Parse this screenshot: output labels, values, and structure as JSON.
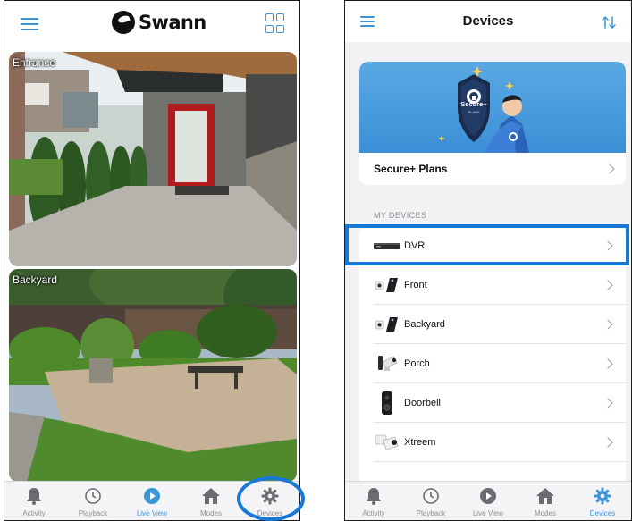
{
  "left_screen": {
    "header": {
      "logo_text": "Swann"
    },
    "cameras": [
      {
        "label": "Entrance"
      },
      {
        "label": "Backyard"
      }
    ],
    "tabs": [
      {
        "label": "Activity",
        "icon": "bell-icon"
      },
      {
        "label": "Playback",
        "icon": "history-icon"
      },
      {
        "label": "Live View",
        "icon": "play-icon"
      },
      {
        "label": "Modes",
        "icon": "home-icon"
      },
      {
        "label": "Devices",
        "icon": "gear-icon"
      }
    ],
    "active_tab": "Live View"
  },
  "right_screen": {
    "header": {
      "title": "Devices"
    },
    "promo": {
      "title": "Secure+ Plans",
      "badge_text": "Secure+",
      "badge_subtext": "PLANS"
    },
    "section_header": "MY DEVICES",
    "devices": [
      {
        "name": "DVR",
        "icon": "dvr-icon"
      },
      {
        "name": "Front",
        "icon": "bullet-camera-icon"
      },
      {
        "name": "Backyard",
        "icon": "bullet-camera-icon"
      },
      {
        "name": "Porch",
        "icon": "spotlight-camera-icon"
      },
      {
        "name": "Doorbell",
        "icon": "doorbell-icon"
      },
      {
        "name": "Xtreem",
        "icon": "battery-camera-icon"
      }
    ],
    "tabs": [
      {
        "label": "Activity",
        "icon": "bell-icon"
      },
      {
        "label": "Playback",
        "icon": "history-icon"
      },
      {
        "label": "Live View",
        "icon": "play-icon"
      },
      {
        "label": "Modes",
        "icon": "home-icon"
      },
      {
        "label": "Devices",
        "icon": "gear-icon"
      }
    ],
    "active_tab": "Devices"
  },
  "colors": {
    "accent": "#3b96d8",
    "highlight": "#1878d6",
    "inactive": "#8e8e93"
  }
}
